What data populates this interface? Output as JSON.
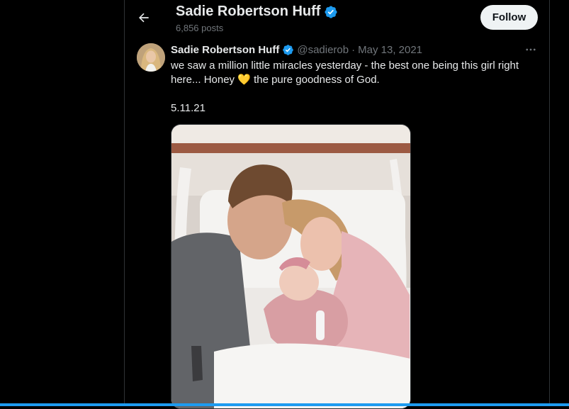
{
  "header": {
    "name": "Sadie Robertson Huff",
    "posts": "6,856 posts",
    "follow_label": "Follow"
  },
  "tweet": {
    "name": "Sadie Robertson Huff",
    "handle": "@sadierob",
    "separator": "·",
    "date": "May 13, 2021",
    "text_part1": "we saw a million little miracles yesterday - the best one being this girl right here... Honey ",
    "emoji": "💛",
    "text_part2": " the pure goodness of God.",
    "date_line": "5.11.21"
  },
  "icons": {
    "back": "arrow-left-icon",
    "verified": "verified-badge-icon",
    "more": "more-horizontal-icon"
  },
  "colors": {
    "background": "#000000",
    "text": "#e7e9ea",
    "muted": "#71767b",
    "verified": "#1d9bf0",
    "follow_bg": "#eff3f4",
    "accent_bar": "#1d9bf0"
  }
}
